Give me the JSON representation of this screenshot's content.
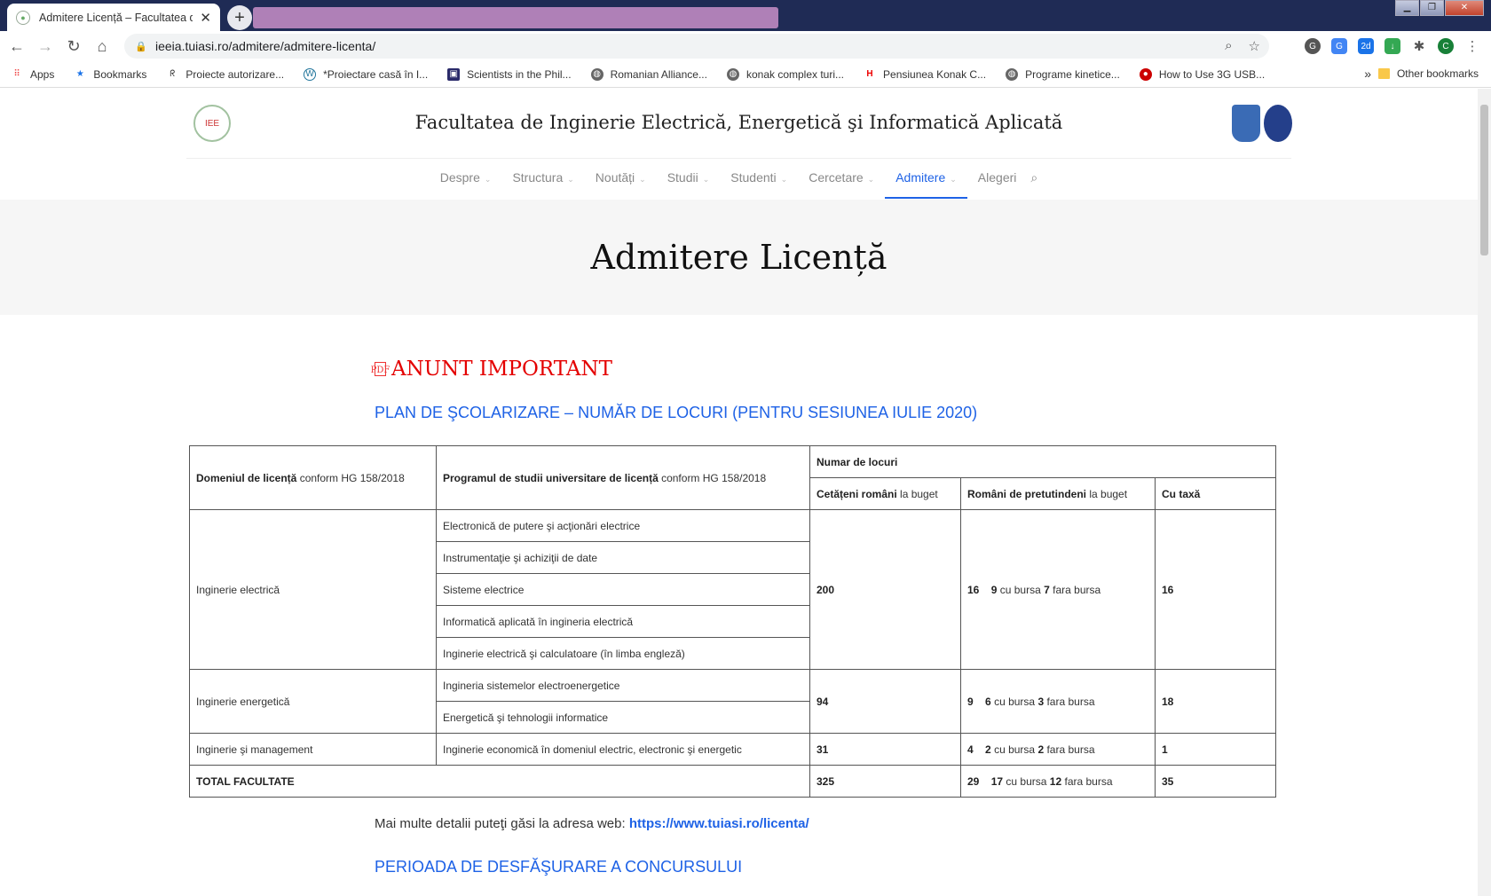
{
  "browser": {
    "tab_title": "Admitere Licență – Facultatea de",
    "url": "ieeia.tuiasi.ro/admitere/admitere-licenta/",
    "profile_initial": "C"
  },
  "bookmarks": {
    "items": [
      "Apps",
      "Bookmarks",
      "Proiecte autorizare...",
      "*Proiectare casă în I...",
      "Scientists in the Phil...",
      "Romanian Alliance...",
      "konak complex turi...",
      "Pensiunea Konak C...",
      "Programe kinetice...",
      "How to Use 3G USB..."
    ],
    "more": "»",
    "other": "Other bookmarks"
  },
  "site": {
    "title": "Facultatea de Inginerie Electrică, Energetică şi Informatică Aplicată",
    "nav": [
      {
        "label": "Despre",
        "chev": "⌄"
      },
      {
        "label": "Structura",
        "chev": "⌄"
      },
      {
        "label": "Noutăți",
        "chev": "⌄"
      },
      {
        "label": "Studii",
        "chev": "⌄"
      },
      {
        "label": "Studenti",
        "chev": "⌄"
      },
      {
        "label": "Cercetare",
        "chev": "⌄"
      },
      {
        "label": "Admitere",
        "chev": "⌄"
      },
      {
        "label": "Alegeri",
        "chev": ""
      }
    ]
  },
  "page": {
    "heading": "Admitere Licență",
    "notice": "ANUNT IMPORTANT",
    "plan_title": "PLAN DE ŞCOLARIZARE – NUMĂR DE LOCURI (PENTRU SESIUNEA IULIE 2020)",
    "more_text": "Mai multe detalii puteţi găsi la adresa web: ",
    "more_link": "https://www.tuiasi.ro/licenta/",
    "period_title": "PERIOADA  DE DESFĂŞURARE A CONCURSULUI"
  },
  "table": {
    "h_domain_b": "Domeniul de licență",
    "h_domain_n": " conform HG 158/2018",
    "h_program_b": "Programul de studii universitare de licență",
    "h_program_n": " conform HG 158/2018",
    "h_places": "Numar de locuri",
    "h_ro_b": "Cetățeni români",
    "h_ro_n": " la buget",
    "h_abroad_b": "Români de pretutindeni",
    "h_abroad_n": " la buget",
    "h_fee": "Cu taxă",
    "domain1": "Inginerie electrică",
    "programs1": [
      "Electronică de putere şi acţionări electrice",
      "Instrumentaţie şi achiziţii de date",
      "Sisteme electrice",
      "Informatică aplicată în ingineria electrică",
      "Inginerie electrică şi calculatoare (în limba engleză)"
    ],
    "ro1": "200",
    "ab1_total": "16",
    "ab1_with": "9",
    "ab1_without": "7",
    "fee1": "16",
    "domain2": "Inginerie energetică",
    "programs2": [
      "Ingineria sistemelor electroenergetice",
      "Energetică şi tehnologii informatice"
    ],
    "ro2": "94",
    "ab2_total": "9",
    "ab2_with": "6",
    "ab2_without": "3",
    "fee2": "18",
    "domain3": "Inginerie şi management",
    "program3": "Inginerie economică în domeniul electric, electronic şi energetic",
    "ro3": "31",
    "ab3_total": "4",
    "ab3_with": "2",
    "ab3_without": "2",
    "fee3": "1",
    "total_label": "TOTAL FACULTATE",
    "ro_total": "325",
    "ab_total": "29",
    "ab_total_with": "17",
    "ab_total_without": "12",
    "fee_total": "35",
    "with_label": "cu bursa",
    "without_label": "fara bursa"
  }
}
